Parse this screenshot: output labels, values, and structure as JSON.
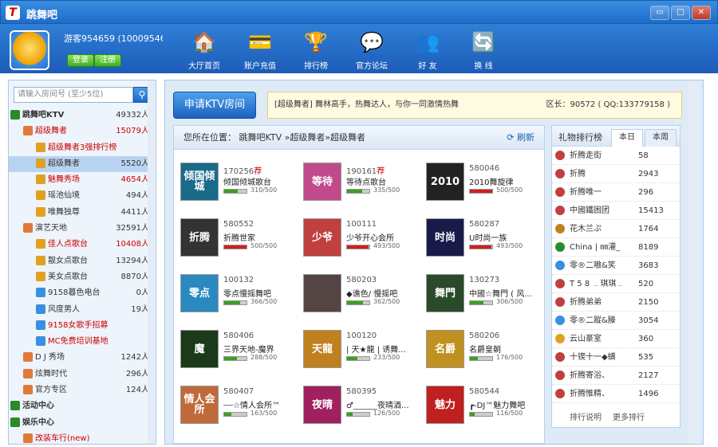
{
  "window": {
    "title": "跳舞吧",
    "controls": [
      "▭",
      "□",
      "✕"
    ]
  },
  "user": {
    "name": "游客954659 (100095465(",
    "login": "登录",
    "register": "注册"
  },
  "nav": [
    {
      "label": "大厅首页",
      "icon": "house-icon",
      "glyph": "🏠"
    },
    {
      "label": "账户充值",
      "icon": "wallet-icon",
      "glyph": "💳"
    },
    {
      "label": "排行榜",
      "icon": "ranking-icon",
      "glyph": "🏆"
    },
    {
      "label": "官方论坛",
      "icon": "forum-icon",
      "glyph": "💬"
    },
    {
      "label": "好 友",
      "icon": "friends-icon",
      "glyph": "👥"
    },
    {
      "label": "换 线",
      "icon": "switch-icon",
      "glyph": "🔄"
    }
  ],
  "search": {
    "placeholder": "请输入房间号 (至少5位)"
  },
  "tree": [
    {
      "label": "跳舞吧KTV",
      "count": "49332人",
      "indent": 2,
      "bold": true,
      "icon": "#2a8a2a"
    },
    {
      "label": "超级舞者",
      "count": "15079人",
      "indent": 18,
      "red": true,
      "icon": "#e07a3a"
    },
    {
      "label": "超级舞者3强排行榜",
      "count": "",
      "indent": 34,
      "red": true,
      "icon": "#e0a020"
    },
    {
      "label": "超级舞者",
      "count": "5520人",
      "indent": 34,
      "sel": true,
      "icon": "#e0a020"
    },
    {
      "label": "魅舞秀场",
      "count": "4654人",
      "indent": 34,
      "red": true,
      "icon": "#e0a020"
    },
    {
      "label": "瑶池仙境",
      "count": "494人",
      "indent": 34,
      "icon": "#e0a020"
    },
    {
      "label": "唯舞独尊",
      "count": "4411人",
      "indent": 34,
      "icon": "#e0a020"
    },
    {
      "label": "演艺天地",
      "count": "32591人",
      "indent": 18,
      "icon": "#e07a3a"
    },
    {
      "label": "佳人点歌台",
      "count": "10408人",
      "indent": 34,
      "red": true,
      "icon": "#e0a020"
    },
    {
      "label": "靓女点歌台",
      "count": "13294人",
      "indent": 34,
      "icon": "#e0a020"
    },
    {
      "label": "美女点歌台",
      "count": "8870人",
      "indent": 34,
      "icon": "#e0a020"
    },
    {
      "label": "9158暮色电台",
      "count": "0人",
      "indent": 34,
      "icon": "#3a8fe0"
    },
    {
      "label": "风度男人",
      "count": "19人",
      "indent": 34,
      "icon": "#3a8fe0"
    },
    {
      "label": "9158女歌手招募",
      "count": "",
      "indent": 34,
      "red": true,
      "icon": "#3a8fe0"
    },
    {
      "label": "MC免费培训基地",
      "count": "",
      "indent": 34,
      "red": true,
      "icon": "#3a8fe0"
    },
    {
      "label": "D J 秀场",
      "count": "1242人",
      "indent": 18,
      "icon": "#e07a3a"
    },
    {
      "label": "炫舞时代",
      "count": "296人",
      "indent": 18,
      "icon": "#e07a3a"
    },
    {
      "label": "官方专区",
      "count": "124人",
      "indent": 18,
      "icon": "#e07a3a"
    },
    {
      "label": "活动中心",
      "count": "",
      "indent": 2,
      "bold": true,
      "icon": "#2a8a2a"
    },
    {
      "label": "娱乐中心",
      "count": "",
      "indent": 2,
      "bold": true,
      "icon": "#2a8a2a"
    },
    {
      "label": "改装车行(new)",
      "count": "",
      "indent": 18,
      "red": true,
      "icon": "#e07a3a"
    }
  ],
  "apply_button": "申请KTV房间",
  "notice": {
    "text": "[超级舞者] 舞林高手，热舞达人，与你一同激情热舞",
    "owner": "区长：90572 ( QQ:133779158 )"
  },
  "location": {
    "text": "您所在位置：  跳舞吧KTV »超级舞者»超级舞者",
    "refresh": "刷新"
  },
  "rooms": [
    {
      "id": "170256",
      "hot": "荐",
      "name": "倾国倾城歌台",
      "cap": "310/500",
      "fill": 0.62,
      "thumb": "倾国倾城",
      "bg": "#1a6a8a"
    },
    {
      "id": "190161",
      "hot": "荐",
      "name": "等待点歌台",
      "cap": "335/500",
      "fill": 0.67,
      "thumb": "等待",
      "bg": "#c04a8a"
    },
    {
      "id": "580046",
      "hot": "",
      "name": "2010舞旋律",
      "cap": "500/500",
      "fill": 1.0,
      "thumb": "2010",
      "bg": "#222"
    },
    {
      "id": "580552",
      "hot": "",
      "name": "折腾世家",
      "cap": "500/500",
      "fill": 1.0,
      "thumb": "折腾",
      "bg": "#333"
    },
    {
      "id": "100111",
      "hot": "",
      "name": "少爷开心会所",
      "cap": "493/500",
      "fill": 0.98,
      "thumb": "少爷",
      "bg": "#c04040"
    },
    {
      "id": "580287",
      "hot": "",
      "name": "U时尚一族",
      "cap": "493/500",
      "fill": 0.98,
      "thumb": "时尚",
      "bg": "#1a1a4a"
    },
    {
      "id": "100132",
      "hot": "",
      "name": "零点慢摇舞吧",
      "cap": "366/500",
      "fill": 0.73,
      "thumb": "零点",
      "bg": "#2a8ac0"
    },
    {
      "id": "580203",
      "hot": "",
      "name": "◆谯色/ 慢摇吧",
      "cap": "362/500",
      "fill": 0.72,
      "thumb": "",
      "bg": "#554444"
    },
    {
      "id": "130273",
      "hot": "",
      "name": "中國☆舞門 ( 风...",
      "cap": "306/500",
      "fill": 0.61,
      "thumb": "舞門",
      "bg": "#2a4a2a"
    },
    {
      "id": "580406",
      "hot": "",
      "name": "三界天地-魔界",
      "cap": "288/500",
      "fill": 0.58,
      "thumb": "魔",
      "bg": "#1a3a1a"
    },
    {
      "id": "100120",
      "hot": "",
      "name": "| 天★龍 | 诱舞...",
      "cap": "233/500",
      "fill": 0.47,
      "thumb": "天龍",
      "bg": "#c08020"
    },
    {
      "id": "580206",
      "hot": "",
      "name": "名爵皇朝",
      "cap": "176/500",
      "fill": 0.35,
      "thumb": "名爵",
      "bg": "#c09020"
    },
    {
      "id": "580407",
      "hot": "",
      "name": "┄┄☆情人会所™",
      "cap": "163/500",
      "fill": 0.33,
      "thumb": "情人会所",
      "bg": "#c06a3a"
    },
    {
      "id": "580395",
      "hot": "",
      "name": "♂______夜晴酒...",
      "cap": "126/500",
      "fill": 0.25,
      "thumb": "夜晴",
      "bg": "#a02060"
    },
    {
      "id": "580544",
      "hot": "",
      "name": "┏-DJ™魅力舞吧",
      "cap": "116/500",
      "fill": 0.23,
      "thumb": "魅力",
      "bg": "#c02020"
    }
  ],
  "rank": {
    "title": "礼物排行榜",
    "tabs": [
      "本日",
      "本周"
    ],
    "footer_left": "排行说明",
    "footer_right": "更多排行",
    "items": [
      {
        "name": "折腾走街",
        "value": "58",
        "c": "#c04040"
      },
      {
        "name": "折腾",
        "value": "2943",
        "c": "#c04040"
      },
      {
        "name": "折腾唯一",
        "value": "296",
        "c": "#c04040"
      },
      {
        "name": "中國鐵困团",
        "value": "15413",
        "c": "#c04040"
      },
      {
        "name": "花木兰ぷ",
        "value": "1764",
        "c": "#c08020"
      },
      {
        "name": "China | ㎜灌_",
        "value": "8189",
        "c": "#2a8a2a"
      },
      {
        "name": "零®二嗷&笑",
        "value": "3683",
        "c": "#3a8fe0"
      },
      {
        "name": "T 5 8 ﹍琪琪﹍",
        "value": "520",
        "c": "#c04040"
      },
      {
        "name": "折腾弟弟",
        "value": "2150",
        "c": "#c04040"
      },
      {
        "name": "零®二蹤&滕",
        "value": "3054",
        "c": "#3a8fe0"
      },
      {
        "name": "云山豪室",
        "value": "360",
        "c": "#e0a020"
      },
      {
        "name": "十锲十一◆蟥",
        "value": "535",
        "c": "#c04040"
      },
      {
        "name": "折腾寄浴、",
        "value": "2127",
        "c": "#c04040"
      },
      {
        "name": "折腾惟精、",
        "value": "1496",
        "c": "#c04040"
      }
    ]
  }
}
